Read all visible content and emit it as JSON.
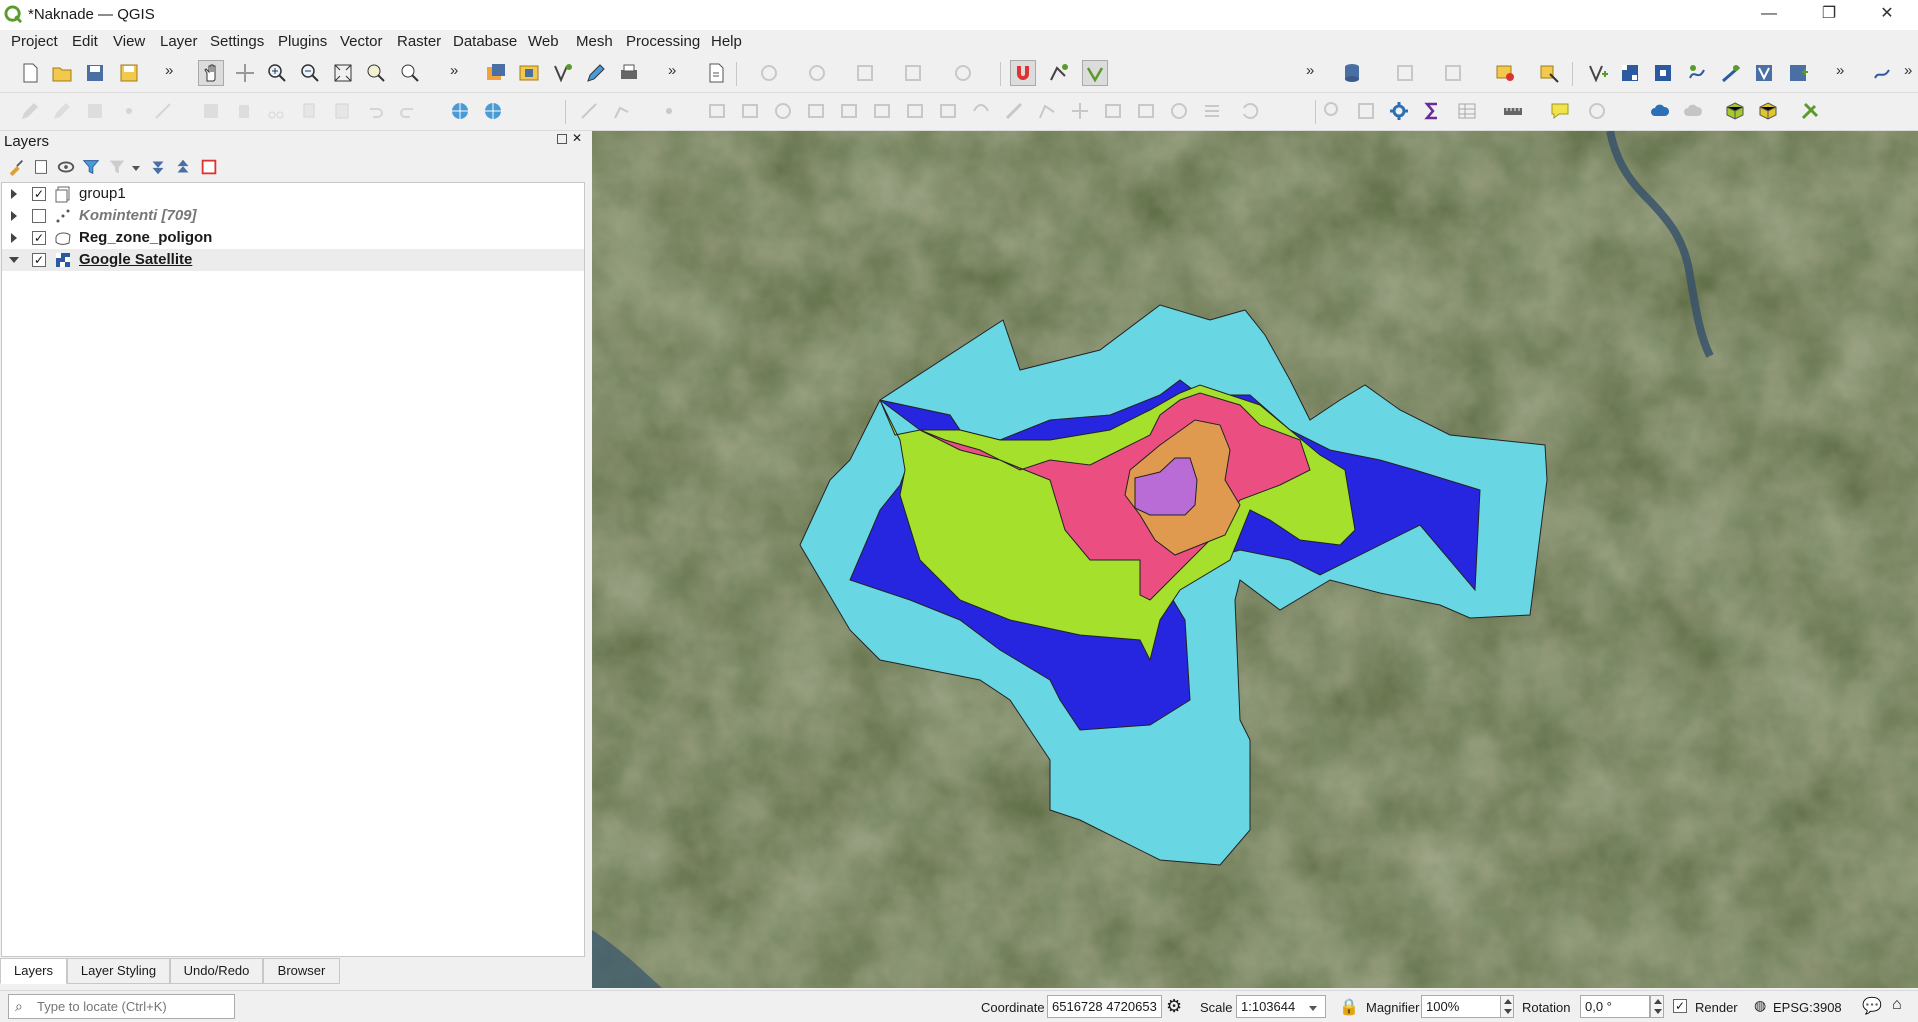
{
  "window": {
    "title": "*Naknade — QGIS",
    "minimize": "—",
    "restore": "❐",
    "close": "✕"
  },
  "menu": [
    "Project",
    "Edit",
    "View",
    "Layer",
    "Settings",
    "Plugins",
    "Vector",
    "Raster",
    "Database",
    "Web",
    "Mesh",
    "Processing",
    "Help"
  ],
  "toolbar": {
    "snapping_tolerance": "12"
  },
  "layers_panel": {
    "title": "Layers",
    "layers": [
      {
        "name": "group1",
        "checked": true,
        "expanded": false,
        "style": "normal"
      },
      {
        "name": "Komintenti [709]",
        "checked": false,
        "expanded": false,
        "style": "italic"
      },
      {
        "name": "Reg_zone_poligon",
        "checked": true,
        "expanded": false,
        "style": "bold"
      },
      {
        "name": "Google Satellite",
        "checked": true,
        "expanded": true,
        "style": "bold-underline"
      }
    ],
    "tabs": [
      "Layers",
      "Layer Styling",
      "Undo/Redo",
      "Browser"
    ],
    "active_tab": "Layers"
  },
  "locator": {
    "placeholder": "Type to locate (Ctrl+K)"
  },
  "status": {
    "coordinate_label": "Coordinate",
    "coordinate_value": "6516728 4720653",
    "scale_label": "Scale",
    "scale_value": "1:103644",
    "magnifier_label": "Magnifier",
    "magnifier_value": "100%",
    "rotation_label": "Rotation",
    "rotation_value": "0,0 °",
    "render_label": "Render",
    "render_checked": true,
    "crs": "EPSG:3908"
  },
  "colors": {
    "zone_outer": "#69d7e3",
    "zone_blue": "#2626e0",
    "zone_green": "#a5e02c",
    "zone_pink": "#eb4f82",
    "zone_orange": "#e09a4f",
    "zone_purple": "#b96bd6",
    "accent_green": "#5b9a2c"
  }
}
